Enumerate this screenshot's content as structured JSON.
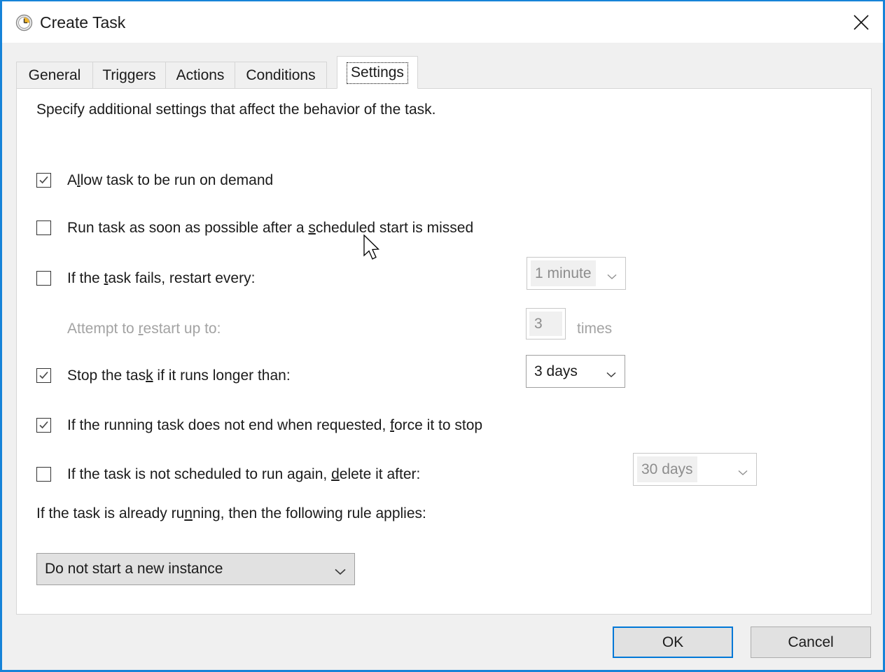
{
  "window": {
    "title": "Create Task",
    "title_icon": "clock-icon",
    "close_icon": "close-icon",
    "accent_color": "#1683d8",
    "dialog_background": "#f0f0f0"
  },
  "tabs": [
    {
      "label": "General",
      "active": false
    },
    {
      "label": "Triggers",
      "active": false
    },
    {
      "label": "Actions",
      "active": false
    },
    {
      "label": "Conditions",
      "active": false
    },
    {
      "label": "Settings",
      "active": true
    }
  ],
  "panel": {
    "intro": "Specify additional settings that affect the behavior of the task.",
    "rows": [
      {
        "name": "allow-on-demand",
        "label_before": "A",
        "label_accel": "l",
        "label_after": "low task to be run on demand",
        "checked": true,
        "enabled": true
      },
      {
        "name": "run-asap-after-missed",
        "label_before": "Run task as soon as possible after a ",
        "label_accel": "s",
        "label_after": "cheduled start is missed",
        "checked": false,
        "enabled": true
      },
      {
        "name": "restart-on-failure",
        "label_before": "If the ",
        "label_accel": "t",
        "label_after": "ask fails, restart every:",
        "checked": false,
        "enabled": true
      },
      {
        "name": "attempt-restart-up-to",
        "label_before": "Attempt to ",
        "label_accel": "r",
        "label_after": "estart up to:",
        "checked": null,
        "enabled": false
      },
      {
        "name": "stop-if-runs-longer",
        "label_before": "Stop the tas",
        "label_accel": "k",
        "label_after": " if it runs longer than:",
        "checked": true,
        "enabled": true
      },
      {
        "name": "force-stop-if-not-ending",
        "label_before": "If the running task does not end when requested, ",
        "label_accel": "f",
        "label_after": "orce it to stop",
        "checked": true,
        "enabled": true
      },
      {
        "name": "delete-if-not-rescheduled",
        "label_before": "If the task is not scheduled to run again, ",
        "label_accel": "d",
        "label_after": "elete it after:",
        "checked": false,
        "enabled": true
      }
    ],
    "restart_interval": {
      "value": "1 minute",
      "enabled": false
    },
    "restart_attempts": {
      "value": "3",
      "suffix": "times",
      "enabled": false
    },
    "stop_after": {
      "value": "3 days",
      "enabled": true
    },
    "delete_after": {
      "value": "30 days",
      "enabled": false
    },
    "already_running_label_before": "If the task is already ru",
    "already_running_label_accel": "n",
    "already_running_label_after": "ning, then the following rule applies:",
    "already_running_rule": {
      "value": "Do not start a new instance",
      "enabled": true
    }
  },
  "footer": {
    "ok_label": "OK",
    "cancel_label": "Cancel"
  },
  "cursor": {
    "icon": "arrow-cursor"
  }
}
